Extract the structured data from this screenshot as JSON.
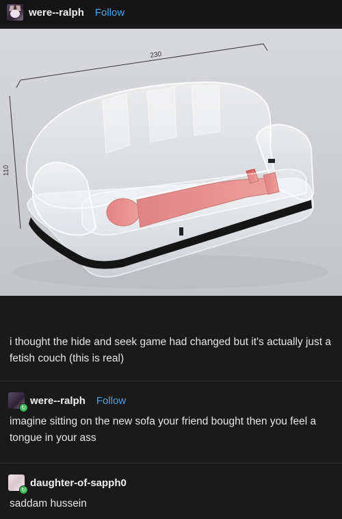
{
  "post": {
    "author": "were--ralph",
    "follow_label": "Follow",
    "image": {
      "dimension_width_label": "230",
      "dimension_height_label": "110"
    },
    "caption": "i thought the hide and seek game had changed but it's actually just a fetish couch (this is real)"
  },
  "reblogs": [
    {
      "author": "were--ralph",
      "follow_label": "Follow",
      "text": "imagine sitting on the new sofa your friend bought then you feel a tongue in your ass"
    },
    {
      "author": "daughter-of-sapph0",
      "text": "saddam hussein"
    }
  ],
  "colors": {
    "background": "#1a1a1a",
    "follow_link": "#4aa3e6",
    "badge": "#3fba5a"
  }
}
